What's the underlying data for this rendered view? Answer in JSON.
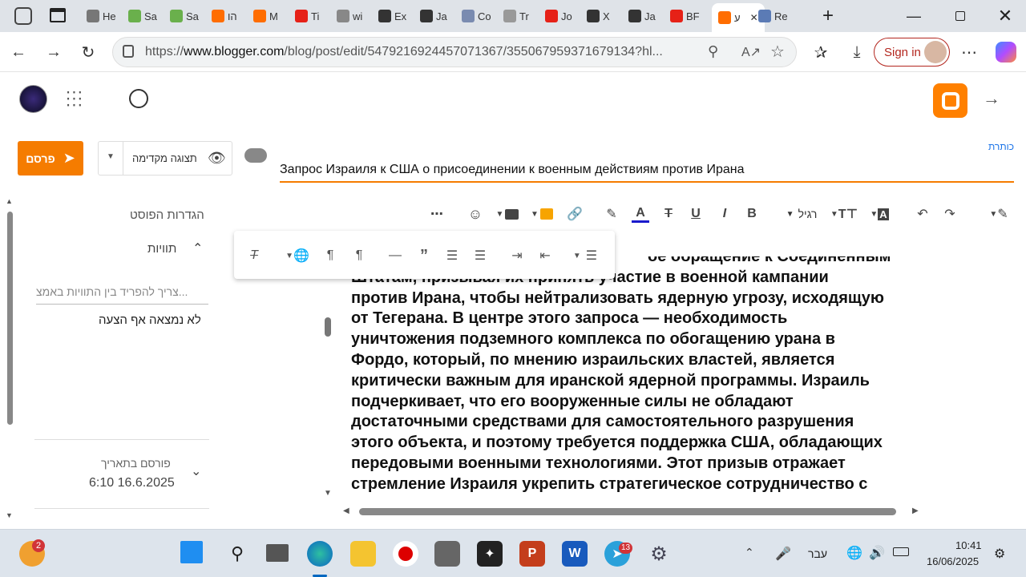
{
  "browser": {
    "tabs": [
      {
        "label": "He",
        "icon": "star-icon",
        "color": "#777"
      },
      {
        "label": "Sa",
        "icon": "play-icon",
        "color": "#6ab04c"
      },
      {
        "label": "Sa",
        "icon": "play-icon",
        "color": "#6ab04c"
      },
      {
        "label": "הו",
        "icon": "blogger-icon",
        "color": "#ff6d00"
      },
      {
        "label": "M",
        "icon": "blogger-icon",
        "color": "#ff6d00"
      },
      {
        "label": "Ti",
        "icon": "youtube-icon",
        "color": "#e62117"
      },
      {
        "label": "wi",
        "icon": "page-icon",
        "color": "#888"
      },
      {
        "label": "Ex",
        "icon": "x-icon",
        "color": "#333"
      },
      {
        "label": "Ja",
        "icon": "x-icon",
        "color": "#333"
      },
      {
        "label": "Co",
        "icon": "feather-icon",
        "color": "#7a8bb0"
      },
      {
        "label": "Tr",
        "icon": "robot-icon",
        "color": "#999"
      },
      {
        "label": "Jo",
        "icon": "youtube-icon",
        "color": "#e62117"
      },
      {
        "label": "X",
        "icon": "x-icon",
        "color": "#333"
      },
      {
        "label": "Ja",
        "icon": "x-icon",
        "color": "#333"
      },
      {
        "label": "BF",
        "icon": "youtube-icon",
        "color": "#e62117"
      },
      {
        "label": "ע",
        "icon": "blogger-icon",
        "color": "#ff6d00",
        "active": true
      },
      {
        "label": "Re",
        "icon": "times-icon",
        "color": "#5b7bb5"
      }
    ],
    "url_prefix": "https://",
    "url_domain": "www.blogger.com",
    "url_path": "/blog/post/edit/5479216924457071367/355067959371679134?hl...",
    "signin_label": "Sign in"
  },
  "editor": {
    "title_label": "כותרת",
    "post_title": "Запрос Израиля к США о присоединении к военным действиям против Ирана",
    "publish_label": "פרסם",
    "preview_label": "תצוגה מקדימה",
    "toolbar": {
      "font_label": "רגיל"
    },
    "settings": {
      "heading": "הגדרות הפוסט",
      "labels_title": "תוויות",
      "labels_placeholder": "צריך להפריד בין התוויות באמצ...",
      "no_suggestions": "לא נמצאה אף הצעה",
      "published_label": "פורסם בתאריך",
      "published_date": "6:10 16.6.2025"
    },
    "body_partial_top": "ое обращение к Соединенным",
    "body_lines": [
      "Штатам, призывая их принять участие в военной кампании",
      "против Ирана, чтобы нейтрализовать ядерную угрозу, исходящую",
      "от Тегерана. В центре этого запроса — необходимость",
      "уничтожения подземного комплекса по обогащению урана в",
      "Фордо, который, по мнению израильских властей, является",
      "критически важным для иранской ядерной программы. Израиль",
      "подчеркивает, что его вооруженные силы не обладают",
      "достаточными средствами для самостоятельного разрушения",
      "этого объекта, и поэтому требуется поддержка США, обладающих",
      "передовыми военными технологиями. Этот призыв отражает",
      "стремление Израиля укрепить стратегическое сотрудничество с"
    ]
  },
  "taskbar": {
    "notification_count": "2",
    "telegram_badge": "13",
    "language": "עבר",
    "time": "10:41",
    "date": "16/06/2025"
  },
  "colors": {
    "accent_orange": "#f57c00",
    "blogger_orange": "#ff8000",
    "link_blue": "#1a73e8"
  }
}
